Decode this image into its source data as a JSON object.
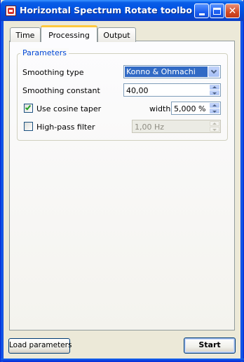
{
  "window": {
    "title": "Horizontal Spectrum Rotate toolbox - ...",
    "controls": [
      "minimize",
      "maximize",
      "close"
    ]
  },
  "tabs": [
    {
      "label": "Time",
      "active": false
    },
    {
      "label": "Processing",
      "active": true
    },
    {
      "label": "Output",
      "active": false
    }
  ],
  "parameters": {
    "group_title": "Parameters",
    "smoothing_type": {
      "label": "Smoothing type",
      "value": "Konno & Ohmachi"
    },
    "smoothing_constant": {
      "label": "Smoothing constant",
      "value": "40,00"
    },
    "cosine_taper": {
      "label": "Use cosine taper",
      "checked": true,
      "width_label": "width",
      "width_value": "5,000 %"
    },
    "high_pass": {
      "label": "High-pass filter",
      "checked": false,
      "value": "1,00 Hz",
      "enabled": false
    }
  },
  "buttons": {
    "load": "Load parameters",
    "start": "Start"
  },
  "icons": {
    "app": "app-icon",
    "minimize": "minimize-icon",
    "maximize": "maximize-icon",
    "close": "close-icon",
    "dropdown": "chevron-down-icon",
    "spin_up": "spin-up-icon",
    "spin_down": "spin-down-icon",
    "check": "checkmark-icon"
  },
  "colors": {
    "titlebar": "#0054e3",
    "selection": "#316ac5",
    "group_title": "#0046d5",
    "active_tab_accent": "#ffc83c",
    "checkmark": "#21a121"
  }
}
